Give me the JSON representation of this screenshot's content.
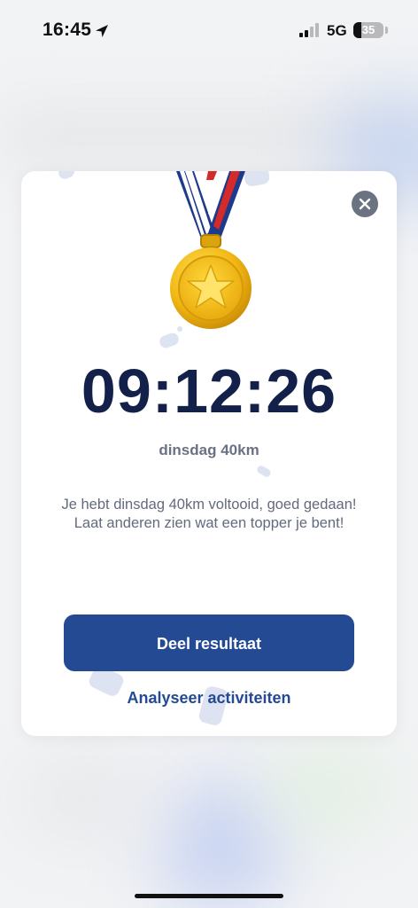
{
  "status_bar": {
    "time": "16:45",
    "network": "5G",
    "battery": "35",
    "battery_level": 0.35,
    "location_icon": "location-arrow-icon",
    "signal_icon": "cellular-signal-icon"
  },
  "modal": {
    "close_icon": "close-icon",
    "medal_icon": "gold-medal-icon",
    "result_time": "09:12:26",
    "event_name": "dinsdag 40km",
    "message": "Je hebt dinsdag 40km voltooid, goed gedaan! Laat anderen zien wat een topper je bent!",
    "share_button_label": "Deel resultaat",
    "analyse_link_label": "Analyseer activiteiten"
  },
  "colors": {
    "primary": "#234a93",
    "title": "#13214a",
    "muted": "#6a7184"
  }
}
